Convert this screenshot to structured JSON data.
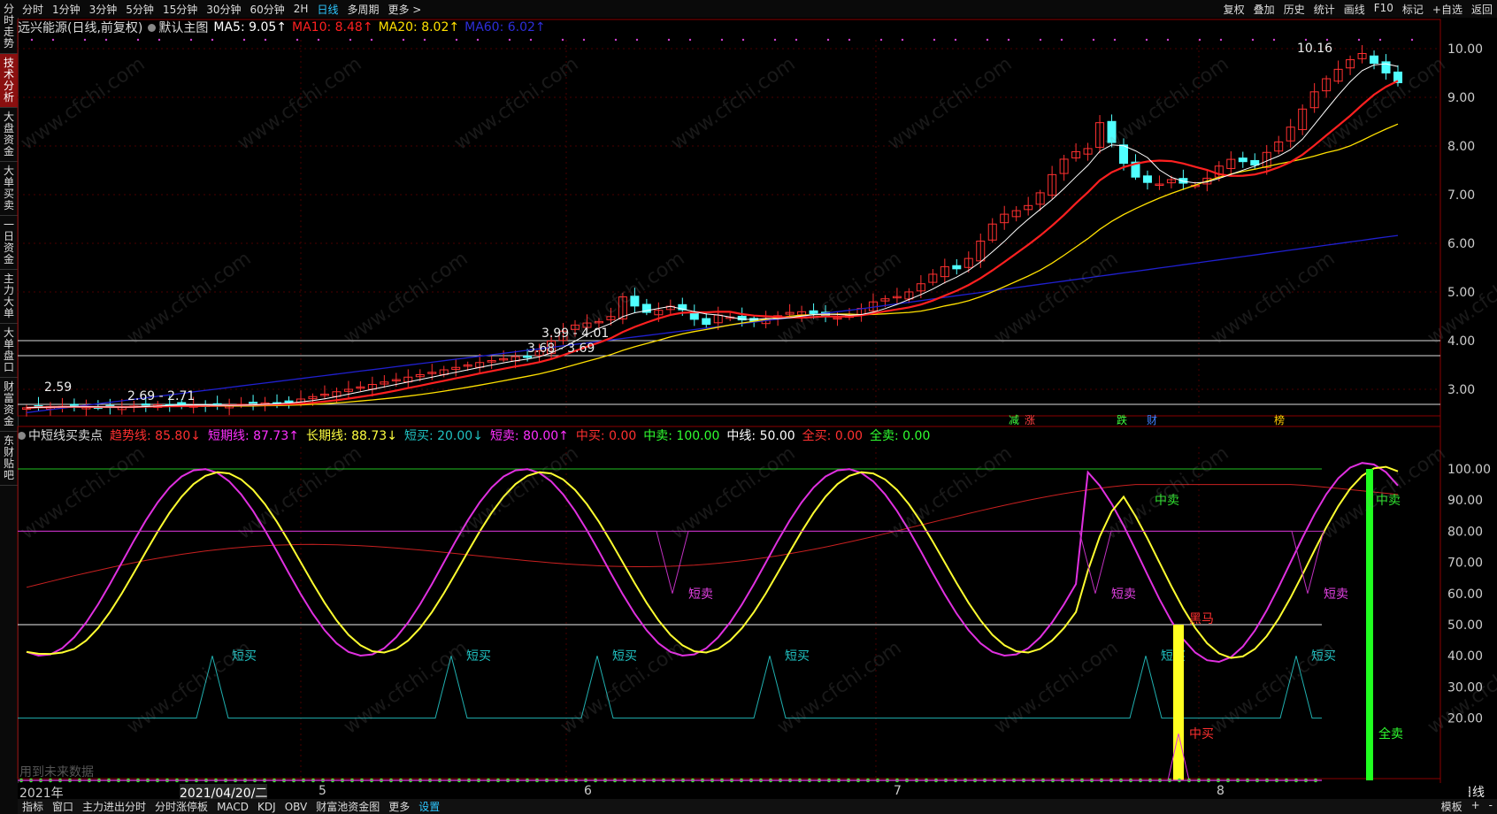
{
  "top_tabs": [
    "分时",
    "1分钟",
    "3分钟",
    "5分钟",
    "15分钟",
    "30分钟",
    "60分钟",
    "2H",
    "日线",
    "多周期",
    "更多 >"
  ],
  "top_right": [
    "复权",
    "叠加",
    "历史",
    "统计",
    "画线",
    "F10",
    "标记",
    "+自选",
    "返回"
  ],
  "side_tabs": [
    "分时走势",
    "技术分析",
    "大盘资金",
    "大单买卖",
    "一日资金",
    "主力大单",
    "大单盘口",
    "财富资金",
    "东财贴吧"
  ],
  "title_bar": {
    "stock": "远兴能源(日线,前复权)",
    "main": "默认主图",
    "ma5": "MA5: 9.05↑",
    "ma10": "MA10: 8.48↑",
    "ma20": "MA20: 8.02↑",
    "ma60": "MA60: 6.02↑"
  },
  "colors": {
    "ma5": "#ffffff",
    "ma10": "#ff2020",
    "ma20": "#ffe000",
    "ma60": "#2020d0",
    "up": "#ff3030",
    "down": "#50ffff",
    "grid": "#5a0000"
  },
  "price_axis": [
    "10.00",
    "9.00",
    "8.00",
    "7.00",
    "6.00",
    "5.00",
    "4.00",
    "3.00"
  ],
  "price_labels": {
    "high": "10.16",
    "p1": "3.99 - 4.01",
    "p2": "3.68 - 3.69",
    "p3": "2.69 - 2.71",
    "low": "2.59"
  },
  "event_marks": [
    {
      "t": "减",
      "c": "#40ff40"
    },
    {
      "t": "涨",
      "c": "#ff4040"
    },
    {
      "t": "跌",
      "c": "#40ff40"
    },
    {
      "t": "财",
      "c": "#4080ff"
    },
    {
      "t": "榜",
      "c": "#ffcc00"
    }
  ],
  "ind_bar": {
    "name": "中短线买卖点",
    "trend": "趋势线: 85.80↓",
    "short_line": "短期线: 87.73↑",
    "long_line": "长期线: 88.73↓",
    "sbuy": "短买: 20.00↓",
    "ssell": "短卖: 80.00↑",
    "mbuy": "中买: 0.00",
    "msell": "中卖: 100.00",
    "mid": "中线: 50.00",
    "abuy": "全买: 0.00",
    "asell": "全卖: 0.00"
  },
  "ind_axis": [
    "100.00",
    "90.00",
    "80.00",
    "70.00",
    "60.00",
    "50.00",
    "40.00",
    "30.00",
    "20.00"
  ],
  "ind_labels": {
    "ssell": "短卖",
    "sbuy": "短买",
    "msell": "中卖",
    "mbuy": "中买",
    "asell": "全卖",
    "heima": "黑马"
  },
  "future_note": "用到未来数据",
  "x_axis": [
    "2021年",
    "2021/04/20/二",
    "5",
    "6",
    "7",
    "8"
  ],
  "period_label": "日线",
  "bottom_tabs": [
    "指标",
    "窗口",
    "主力进出分时",
    "分时涨停板",
    "MACD",
    "KDJ",
    "OBV",
    "财富池资金图",
    "更多",
    "设置"
  ],
  "bottom_right": [
    "模板",
    "+",
    "-"
  ],
  "watermark": "www.cfchi.com"
}
